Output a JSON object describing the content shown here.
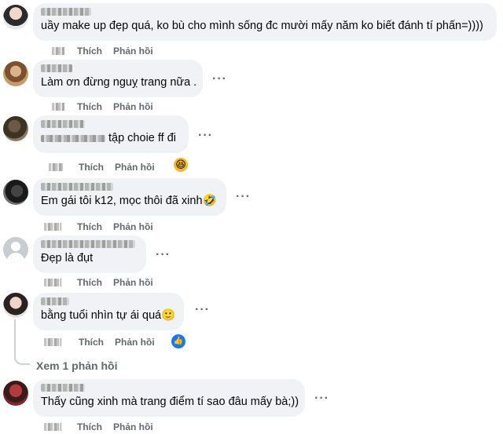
{
  "actions": {
    "like": "Thích",
    "reply": "Phản hồi"
  },
  "comments": [
    {
      "text": "uầy make up đẹp quá, ko bù cho mình sống đc mười mấy năm ko biết đánh tí phấn=))))"
    },
    {
      "text": "Làm ơn đừng nguỵ trang nữa ."
    },
    {
      "text": "tập choie ff đi"
    },
    {
      "text": "Em gái tôi k12, mọc thôi đã xinh🤣"
    },
    {
      "text": "Đẹp là đụt"
    },
    {
      "text": "bằng tuổi nhìn tự ái quá🙂"
    },
    {
      "text": "Thấy cũng xinh mà trang điểm tí sao đâu mấy bà;))"
    }
  ],
  "view_replies": "Xem 1 phản hồi",
  "more_icon": "···",
  "reactions": {
    "haha": "😆",
    "like": "👍"
  },
  "colors": {
    "bubble": "#f0f2f5",
    "meta": "#65676b",
    "like_blue": "#1877f2"
  }
}
